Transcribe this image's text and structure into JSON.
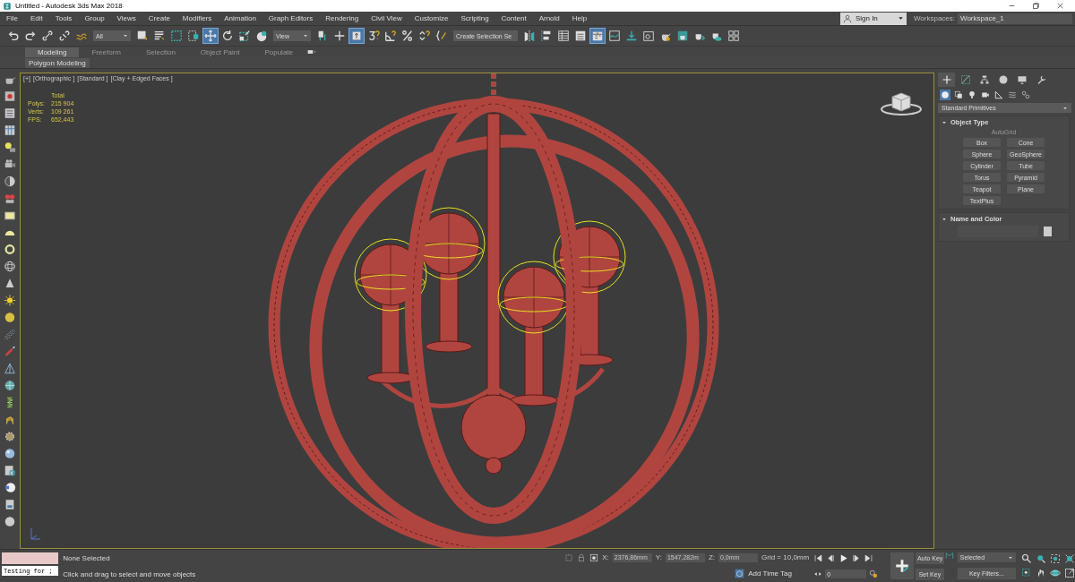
{
  "window": {
    "title": "Untitled - Autodesk 3ds Max 2018"
  },
  "menu": [
    "File",
    "Edit",
    "Tools",
    "Group",
    "Views",
    "Create",
    "Modifiers",
    "Animation",
    "Graph Editors",
    "Rendering",
    "Civil View",
    "Customize",
    "Scripting",
    "Content",
    "Arnold",
    "Help"
  ],
  "account": {
    "sign_in": "Sign In",
    "workspaces_label": "Workspaces:",
    "workspace": "Workspace_1"
  },
  "toolbar": [
    {
      "kind": "button",
      "selected": false
    },
    {
      "kind": "button",
      "selected": false
    },
    {
      "kind": "button",
      "selected": false
    },
    {
      "kind": "button",
      "selected": false
    },
    {
      "kind": "button",
      "selected": false
    },
    {
      "kind": "dropdown",
      "value": "All"
    },
    {
      "kind": "button",
      "selected": false
    },
    {
      "kind": "button",
      "selected": false
    },
    {
      "kind": "button",
      "selected": false
    },
    {
      "kind": "button",
      "selected": false
    },
    {
      "kind": "button",
      "selected": true
    },
    {
      "kind": "button",
      "selected": false
    },
    {
      "kind": "button",
      "selected": false
    },
    {
      "kind": "button",
      "selected": false
    },
    {
      "kind": "dropdown",
      "value": "View"
    },
    {
      "kind": "button",
      "selected": false
    },
    {
      "kind": "button",
      "selected": false
    },
    {
      "kind": "button",
      "selected": true
    },
    {
      "kind": "button",
      "selected": false
    },
    {
      "kind": "button",
      "selected": false
    },
    {
      "kind": "button",
      "selected": false
    },
    {
      "kind": "button",
      "selected": false
    },
    {
      "kind": "button",
      "selected": false
    },
    {
      "kind": "dropdown",
      "value": "Create Selection Se"
    },
    {
      "kind": "button",
      "selected": false
    },
    {
      "kind": "button",
      "selected": false
    },
    {
      "kind": "button",
      "selected": false
    },
    {
      "kind": "button",
      "selected": false
    },
    {
      "kind": "button",
      "selected": true
    },
    {
      "kind": "button",
      "selected": false
    },
    {
      "kind": "button",
      "selected": false
    },
    {
      "kind": "button",
      "selected": false
    },
    {
      "kind": "button",
      "selected": false
    },
    {
      "kind": "button",
      "selected": false
    },
    {
      "kind": "button",
      "selected": false
    },
    {
      "kind": "button",
      "selected": false
    },
    {
      "kind": "button",
      "selected": false
    }
  ],
  "ribbon": {
    "tabs": [
      {
        "label": "Modeling",
        "selected": true
      },
      {
        "label": "Freeform",
        "selected": false
      },
      {
        "label": "Selection",
        "selected": false
      },
      {
        "label": "Object Paint",
        "selected": false
      },
      {
        "label": "Populate",
        "selected": false
      }
    ],
    "panel": "Polygon Modeling"
  },
  "viewport": {
    "labels": [
      "[+]",
      "[Orthographic ]",
      "[Standard ]",
      "[Clay + Edged Faces ]"
    ],
    "stats": [
      {
        "value": "Total"
      },
      {
        "label": "Polys:",
        "value": "215 904"
      },
      {
        "label": "Verts:",
        "value": "109 261"
      },
      {
        "label": "FPS:",
        "value": "652,443"
      }
    ]
  },
  "command_panel": {
    "tabs": [
      {
        "selected": true
      },
      {
        "selected": false
      },
      {
        "selected": false
      },
      {
        "selected": false
      },
      {
        "selected": false
      },
      {
        "selected": false
      }
    ],
    "categories": [
      {
        "selected": true
      },
      {
        "selected": false
      },
      {
        "selected": false
      },
      {
        "selected": false
      },
      {
        "selected": false
      },
      {
        "selected": false
      },
      {
        "selected": false
      }
    ],
    "dropdown": "Standard Primitives",
    "object_type": {
      "title": "Object Type",
      "expanded": true,
      "autogrid": {
        "label": "AutoGrid",
        "disabled": true
      },
      "buttons": [
        "Box",
        "Cone",
        "Sphere",
        "GeoSphere",
        "Cylinder",
        "Tube",
        "Torus",
        "Pyramid",
        "Teapot",
        "Plane",
        "TextPlus"
      ]
    },
    "name_and_color": {
      "title": "Name and Color",
      "expanded": true
    }
  },
  "status": {
    "script_output": "Testing for ;",
    "selection": "None Selected",
    "prompt": "Click and drag to select and move objects",
    "coords": [
      {
        "label": "X:",
        "value": "2376,86mm"
      },
      {
        "label": "Y:",
        "value": "1547,282m"
      },
      {
        "label": "Z:",
        "value": "0,0mm"
      }
    ],
    "grid": "Grid = 10,0mm",
    "time_tag": "Add Time Tag",
    "frame": "0",
    "auto_key": "Auto Key",
    "set_key": "Set Key",
    "key_mode": "Selected",
    "key_filters": "Key Filters..."
  }
}
